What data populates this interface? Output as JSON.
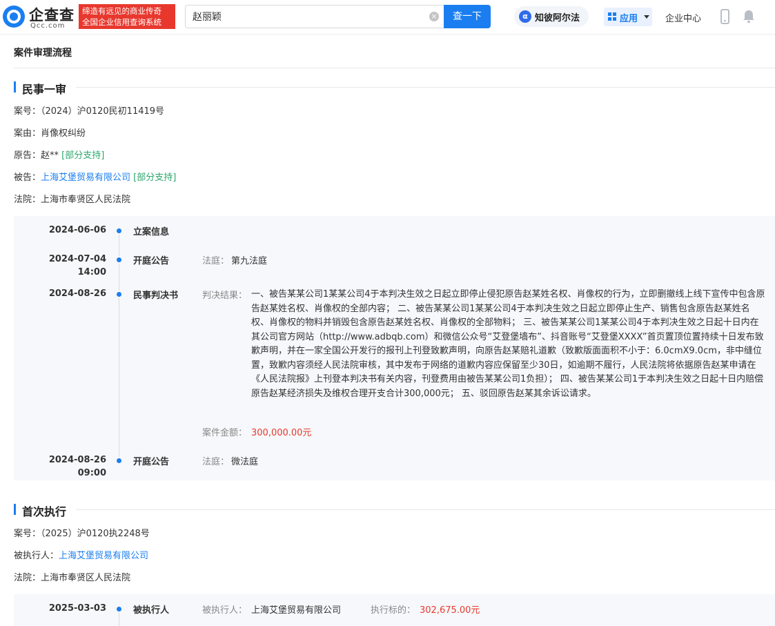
{
  "header": {
    "logo_name": "企查查",
    "logo_domain": "Qcc.com",
    "slogan_line1": "缔造有远见的商业传奇",
    "slogan_line2": "全国企业信用查询系统",
    "search_value": "赵丽颖",
    "search_button": "查一下",
    "alpha_label": "知彼阿尔法",
    "apps_label": "应用",
    "enterprise_center": "企业中心"
  },
  "page": {
    "title": "案件审理流程"
  },
  "first_instance": {
    "heading": "民事一审",
    "case_no_label": "案号：",
    "case_no": "（2024）沪0120民初11419号",
    "cause_label": "案由：",
    "cause": "肖像权纠纷",
    "plaintiff_label": "原告：",
    "plaintiff": "赵**",
    "plaintiff_tag": "[部分支持]",
    "defendant_label": "被告：",
    "defendant": "上海艾堡贸易有限公司",
    "defendant_tag": "[部分支持]",
    "court_label": "法院：",
    "court": "上海市奉贤区人民法院",
    "timeline": [
      {
        "date": "2024-06-06",
        "time": "",
        "event": "立案信息"
      },
      {
        "date": "2024-07-04",
        "time": "14:00",
        "event": "开庭公告",
        "detail_label": "法庭：",
        "detail_value": "第九法庭"
      },
      {
        "date": "2024-08-26",
        "time": "",
        "event": "民事判决书",
        "detail_label": "判决结果：",
        "detail_value": "一、被告某某公司1某某公司4于本判决生效之日起立即停止侵犯原告赵某姓名权、肖像权的行为，立即删撤线上线下宣传中包含原告赵某姓名权、肖像权的全部内容； 二、被告某某公司1某某公司4于本判决生效之日起立即停止生产、销售包含原告赵某姓名权、肖像权的物料并销毁包含原告赵某姓名权、肖像权的全部物料； 三、被告某某公司1某某公司4于本判决生效之日起十日内在其公司官方网站（http://www.adbqb.com）和微信公众号“艾登堡墙布”、抖音账号“艾登堡XXXX”首页置顶位置持续十日发布致歉声明，并在一家全国公开发行的报刊上刊登致歉声明，向原告赵某赔礼道歉（致歉版面面积不小于：6.0cmX9.0cm，非中缝位置，致歉内容须经人民法院审核，其中发布于网络的道歉内容应保留至少30日，如逾期不履行，人民法院将依据原告赵某申请在《人民法院报》上刊登本判决书有关内容，刊登费用由被告某某公司1负担）； 四、被告某某公司1于本判决生效之日起十日内赔偿原告赵某经济损失及维权合理开支合计300,000元； 五、驳回原告赵某其余诉讼请求。",
        "amount_label": "案件金额：",
        "amount_value": "300,000.00元"
      },
      {
        "date": "2024-08-26",
        "time": "09:00",
        "event": "开庭公告",
        "detail_label": "法庭：",
        "detail_value": "微法庭"
      }
    ]
  },
  "first_execution": {
    "heading": "首次执行",
    "case_no_label": "案号：",
    "case_no": "（2025）沪0120执2248号",
    "executed_label": "被执行人：",
    "executed": "上海艾堡贸易有限公司",
    "court_label": "法院：",
    "court": "上海市奉贤区人民法院",
    "timeline": [
      {
        "date": "2025-03-03",
        "event": "被执行人",
        "detail_label": "被执行人：",
        "detail_value": "上海艾堡贸易有限公司",
        "target_label": "执行标的：",
        "target_value": "302,675.00元"
      }
    ]
  },
  "colors": {
    "brand_blue": "#1a7ef0",
    "slogan_red": "#e8382e",
    "amount_red": "#e8382e",
    "tag_green": "#2aa66b",
    "panel_bg": "#f6f8fb"
  },
  "icons": [
    "qcc-logo-icon",
    "clear-icon",
    "alpha-icon",
    "apps-grid-icon",
    "caret-down-icon",
    "phone-icon",
    "bell-icon",
    "timeline-dot-icon"
  ]
}
